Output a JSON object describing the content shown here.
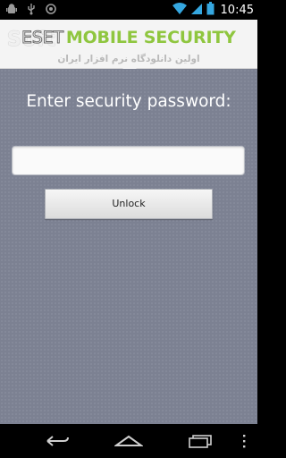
{
  "status_bar": {
    "time": "10:45",
    "left_icons": [
      "android-debug-icon",
      "usb-icon",
      "sync-icon"
    ],
    "right_icons": [
      "wifi-icon",
      "signal-icon",
      "battery-icon"
    ]
  },
  "header": {
    "brand_prefix": "ESET",
    "brand_suffix": "MOBILE SECURITY",
    "watermark": "Soft",
    "subtitle": "اولین دانلودگاه نرم افزار ایران",
    "accent_color": "#8fc63f"
  },
  "main": {
    "prompt": "Enter security password:",
    "password_value": "",
    "unlock_label": "Unlock",
    "background_color": "#7c8192"
  },
  "nav_bar": {
    "buttons": [
      "back-icon",
      "home-icon",
      "recent-apps-icon",
      "menu-icon"
    ]
  }
}
